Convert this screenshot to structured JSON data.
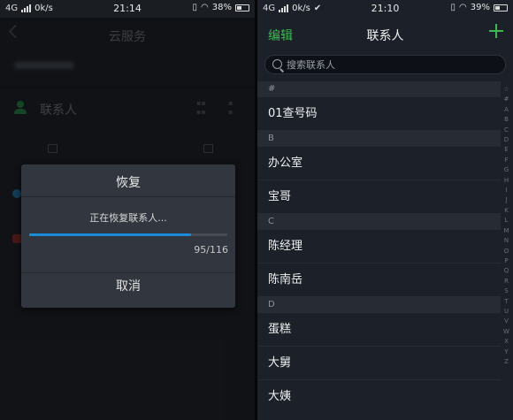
{
  "left_screen": {
    "status": {
      "network": "4G",
      "speed": "0k/s",
      "time": "21:14",
      "battery": "38%"
    },
    "header": {
      "title": "云服务"
    },
    "contacts_entry": {
      "label": "联系人"
    },
    "dialog": {
      "title": "恢复",
      "message": "正在恢复联系人...",
      "progress": {
        "current": 95,
        "total": 116,
        "count_text": "95/116"
      },
      "cancel_label": "取消"
    },
    "colors": {
      "accent_blue": "#1a8bd8",
      "dialog_bg": "#32363e"
    }
  },
  "right_screen": {
    "status": {
      "network": "4G",
      "speed": "0k/s",
      "time": "21:10",
      "battery": "39%"
    },
    "header": {
      "edit_label": "编辑",
      "title": "联系人",
      "add_icon": "plus-icon"
    },
    "search": {
      "placeholder": "搜索联系人"
    },
    "sections": [
      {
        "header": "#",
        "contacts": [
          "01查号码"
        ]
      },
      {
        "header": "B",
        "contacts": [
          "办公室",
          "宝哥"
        ]
      },
      {
        "header": "C",
        "contacts": [
          "陈经理",
          "陈南岳"
        ]
      },
      {
        "header": "D",
        "contacts": [
          "蛋糕",
          "大舅",
          "大姨"
        ]
      }
    ],
    "alpha_index": [
      "☆",
      "#",
      "A",
      "B",
      "C",
      "D",
      "E",
      "F",
      "G",
      "H",
      "I",
      "J",
      "K",
      "L",
      "M",
      "N",
      "O",
      "P",
      "Q",
      "R",
      "S",
      "T",
      "U",
      "V",
      "W",
      "X",
      "Y",
      "Z"
    ],
    "colors": {
      "accent_green": "#3fb854",
      "background": "#1b2029"
    }
  }
}
